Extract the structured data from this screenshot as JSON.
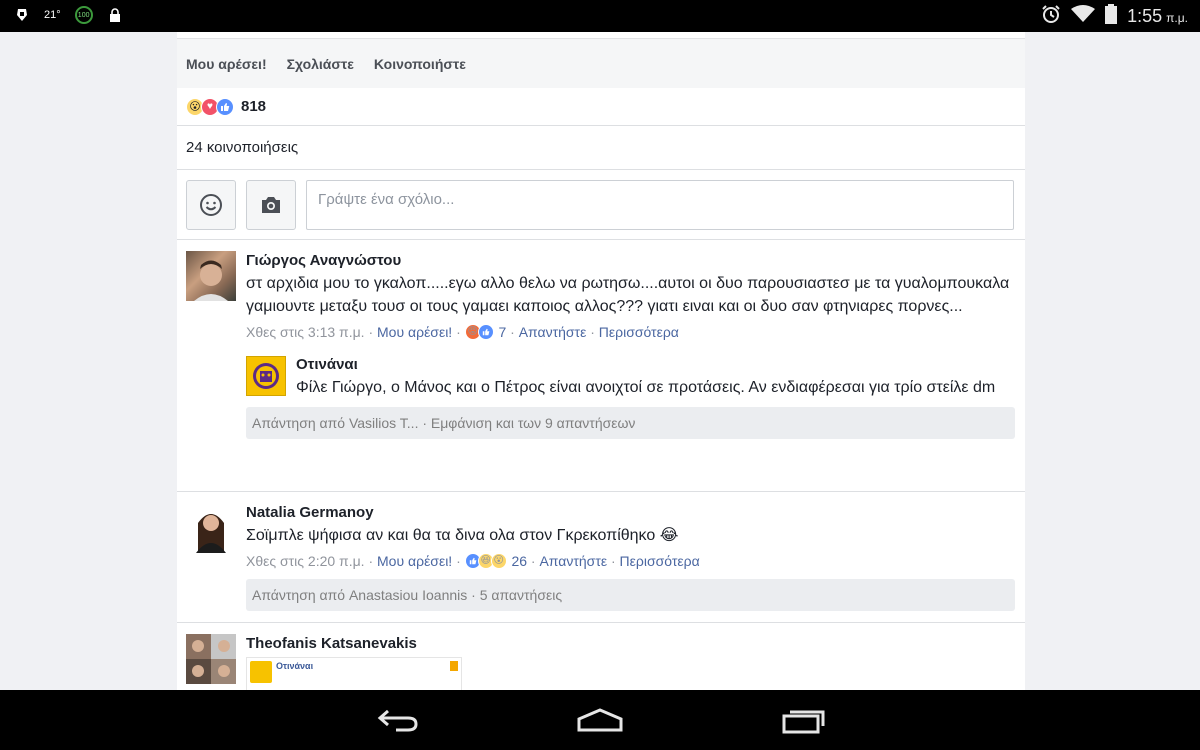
{
  "status_bar": {
    "temp": "21°",
    "battery_badge": "100",
    "time": "1:55",
    "ampm": "π.μ."
  },
  "post": {
    "actions": {
      "like": "Μου αρέσει!",
      "comment": "Σχολιάστε",
      "share": "Κοινοποιήστε"
    },
    "reaction_count": "818",
    "shares": "24 κοινοποιήσεις",
    "composer_placeholder": "Γράψτε ένα σχόλιο..."
  },
  "comments": [
    {
      "author": "Γιώργος Αναγνώστου",
      "text": "στ αρχιδια μου το γκαλοπ.....εγω αλλο θελω να ρωτησω....αυτοι οι δυο παρουσιαστεσ με τα γυαλομπουκαλα γαμιουντε μεταξυ τουσ οι τους γαμαει καποιος αλλος??? γιατι ειναι και οι δυο σαν φτηνιαρες πορνες...",
      "time": "Χθες στις 3:13 π.μ.",
      "like": "Μου αρέσει!",
      "reaction_count": "7",
      "reply": "Απαντήστε",
      "more": "Περισσότερα",
      "sub_reply": {
        "author": "Οτινάναι",
        "text": "Φίλε Γιώργο, ο Μάνος και ο Πέτρος είναι ανοιχτοί σε προτάσεις. Αν ενδιαφέρεσαι για τρίο στείλε dm"
      },
      "replies_bar": "Απάντηση από Vasilios T... · Εμφάνιση και των 9 απαντήσεων"
    },
    {
      "author": "Natalia Germanoy",
      "text": "Σοϊμπλε ψήφισα αν και θα τα δινα ολα στον Γκρεκοπίθηκο 😂",
      "time": "Χθες στις 2:20 π.μ.",
      "like": "Μου αρέσει!",
      "reaction_count": "26",
      "reply": "Απαντήστε",
      "more": "Περισσότερα",
      "replies_bar": "Απάντηση από Anastasiou Ioannis · 5 απαντήσεις"
    },
    {
      "author": "Theofanis Katsanevakis",
      "embedded_title": "Οτινάναι"
    }
  ],
  "colors": {
    "link": "#4b67a1",
    "like_blue": "#5890ff",
    "love_red": "#f25268",
    "haha_yellow": "#fcd669"
  }
}
